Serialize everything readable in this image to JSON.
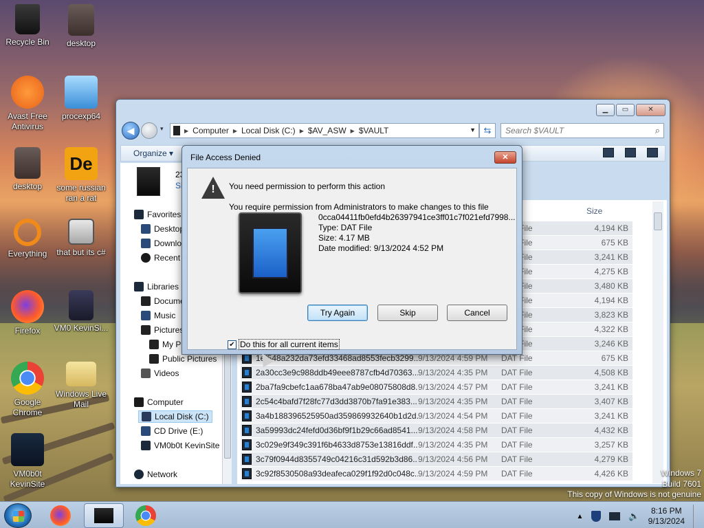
{
  "desktop": {
    "icons": [
      {
        "label": "Recycle Bin"
      },
      {
        "label": "desktop"
      },
      {
        "label": "Avast Free Antivirus"
      },
      {
        "label": "procexp64"
      },
      {
        "label": "desktop"
      },
      {
        "label": "some russian ran a rat"
      },
      {
        "label": "Everything"
      },
      {
        "label": "that but its c#"
      },
      {
        "label": "Firefox"
      },
      {
        "label": "VM0 KevinSi..."
      },
      {
        "label": "Google Chrome"
      },
      {
        "label": "Windows Live Mail"
      },
      {
        "label": "VM0b0t KevinSite"
      }
    ],
    "watermark_line1": "Windows 7",
    "watermark_line2": "Build 7601",
    "genuine": "This copy of Windows is not genuine"
  },
  "explorer": {
    "breadcrumb": [
      "Computer",
      "Local Disk (C:)",
      "$AV_ASW",
      "$VAULT"
    ],
    "search_placeholder": "Search $VAULT",
    "organize": "Organize ▾",
    "header_partial_1": "23",
    "header_partial_2": "Sh",
    "size_header": "Size",
    "nav": [
      {
        "label": "Favorites"
      },
      {
        "label": "Desktop"
      },
      {
        "label": "Downloads"
      },
      {
        "label": "Recent Places"
      },
      {
        "label": "Libraries"
      },
      {
        "label": "Documents"
      },
      {
        "label": "Music"
      },
      {
        "label": "Pictures"
      },
      {
        "label": "My Pictures"
      },
      {
        "label": "Public Pictures"
      },
      {
        "label": "Videos"
      },
      {
        "label": "Computer"
      },
      {
        "label": "Local Disk (C:)"
      },
      {
        "label": "CD Drive (E:)"
      },
      {
        "label": "VM0b0t KevinSite"
      },
      {
        "label": "Network"
      }
    ],
    "rows": [
      {
        "name": "",
        "date": "",
        "type": "DAT File",
        "size": "4,194 KB"
      },
      {
        "name": "",
        "date": "",
        "type": "DAT File",
        "size": "675 KB"
      },
      {
        "name": "",
        "date": "",
        "type": "DAT File",
        "size": "3,241 KB"
      },
      {
        "name": "",
        "date": "",
        "type": "DAT File",
        "size": "4,275 KB"
      },
      {
        "name": "",
        "date": "",
        "type": "DAT File",
        "size": "3,480 KB"
      },
      {
        "name": "",
        "date": "",
        "type": "DAT File",
        "size": "4,194 KB"
      },
      {
        "name": "",
        "date": "",
        "type": "DAT File",
        "size": "3,823 KB"
      },
      {
        "name": "",
        "date": "",
        "type": "DAT File",
        "size": "4,322 KB"
      },
      {
        "name": "",
        "date": "",
        "type": "DAT File",
        "size": "3,246 KB"
      },
      {
        "name": "1ef548a232da73efd33468ad8553fecb3299...",
        "date": "9/13/2024 4:59 PM",
        "type": "DAT File",
        "size": "675 KB"
      },
      {
        "name": "2a30cc3e9c988ddb49eee8787cfb4d70363...",
        "date": "9/13/2024 4:35 PM",
        "type": "DAT File",
        "size": "4,508 KB"
      },
      {
        "name": "2ba7fa9cbefc1aa678ba47ab9e08075808d8...",
        "date": "9/13/2024 4:57 PM",
        "type": "DAT File",
        "size": "3,241 KB"
      },
      {
        "name": "2c54c4bafd7f28fc77d3dd3870b7fa91e383...",
        "date": "9/13/2024 4:35 PM",
        "type": "DAT File",
        "size": "3,407 KB"
      },
      {
        "name": "3a4b188396525950ad359869932640b1d2d...",
        "date": "9/13/2024 4:54 PM",
        "type": "DAT File",
        "size": "3,241 KB"
      },
      {
        "name": "3a59993dc24fefd0d36bf9f1b29c66ad8541...",
        "date": "9/13/2024 4:58 PM",
        "type": "DAT File",
        "size": "4,432 KB"
      },
      {
        "name": "3c029e9f349c391f6b4633d8753e13816ddf...",
        "date": "9/13/2024 4:35 PM",
        "type": "DAT File",
        "size": "3,257 KB"
      },
      {
        "name": "3c79f0944d8355749c04216c31d592b3d86...",
        "date": "9/13/2024 4:56 PM",
        "type": "DAT File",
        "size": "4,279 KB"
      },
      {
        "name": "3c92f8530508a93deafeca029f1f92d0c048c...",
        "date": "9/13/2024 4:59 PM",
        "type": "DAT File",
        "size": "4,426 KB"
      }
    ]
  },
  "dialog": {
    "title": "File Access Denied",
    "close": "✕",
    "message": "You need permission to perform this action",
    "detail": "You require permission from Administrators to make changes to this file",
    "file_name": "0cca04411fb0efd4b26397941ce3ff01c7f021efd7998...",
    "file_type": "Type: DAT File",
    "file_size": "Size: 4.17 MB",
    "file_modified": "Date modified: 9/13/2024 4:52 PM",
    "try_again": "Try Again",
    "skip": "Skip",
    "cancel": "Cancel",
    "do_this": "Do this for all current items",
    "do_this_checked": true
  },
  "taskbar": {
    "time": "8:16 PM",
    "date": "9/13/2024"
  }
}
